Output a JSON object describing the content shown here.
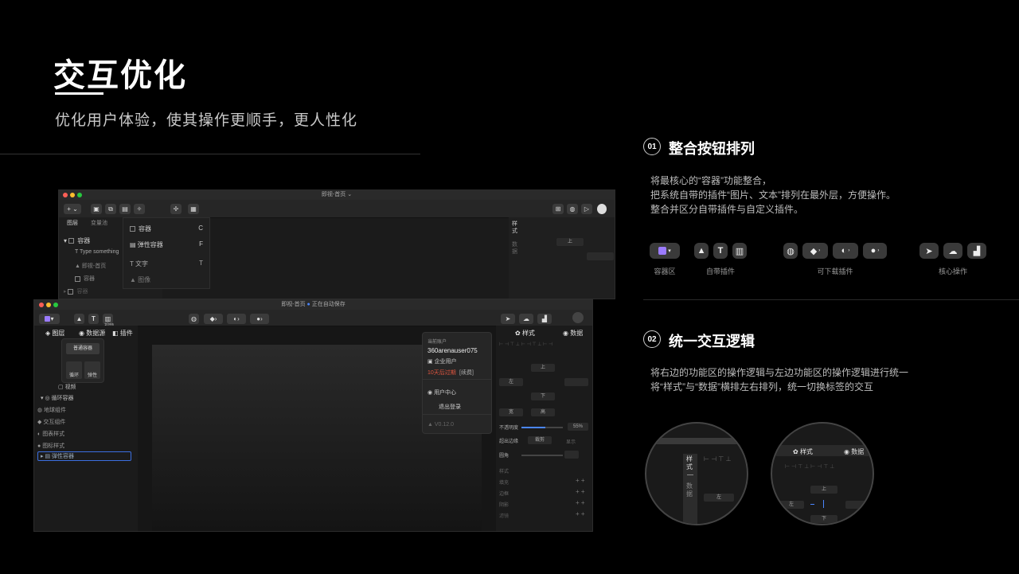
{
  "header": {
    "title": "交互优化",
    "subtitle": "优化用户体验，使其操作更顺手，更人性化"
  },
  "section1": {
    "num": "01",
    "title": "整合按钮排列",
    "desc": "将最核心的“容器”功能整合，\n把系统自带的插件“图片、文本”排列在最外层，方便操作。\n整合并区分自带插件与自定义插件。",
    "groups": [
      {
        "label": "容器区"
      },
      {
        "label": "自带插件"
      },
      {
        "label": "可下载插件"
      },
      {
        "label": "核心操作"
      }
    ]
  },
  "section2": {
    "num": "02",
    "title": "统一交互逻辑",
    "desc": "将右边的功能区的操作逻辑与左边功能区的操作逻辑进行统一\n将“样式”与“数据”横排左右排列，统一切换标签的交互"
  },
  "back_window": {
    "title": "即视-首页",
    "tabs": [
      "图层",
      "变量池"
    ],
    "layers": [
      "容器",
      "Type something",
      "即视-首页",
      "容器",
      "容器"
    ],
    "menu": [
      {
        "label": "容器",
        "key": "C"
      },
      {
        "label": "弹性容器",
        "key": "F"
      },
      {
        "label": "文字",
        "key": "T"
      },
      {
        "label": "图像",
        "key": ""
      }
    ],
    "side_tab": "样式",
    "side_tab2": "数据",
    "field_top": "上"
  },
  "front_window": {
    "title": "即视-首页",
    "autosave": "正在自动保存",
    "tabs": [
      "图层",
      "数据源",
      "插件"
    ],
    "tooltip": "视频",
    "popup_items": [
      "普通容器",
      "循环",
      "弹性"
    ],
    "layers": [
      "视频",
      "循环容器",
      "地球组件",
      "交互组件",
      "图表样式",
      "图标样式",
      "弹性容器"
    ],
    "right_tabs": [
      "样式",
      "数据"
    ],
    "fields": {
      "top": "上",
      "left": "左",
      "bottom": "下",
      "w": "宽",
      "h": "高",
      "opacity_label": "不透明度",
      "opacity_value": "55%",
      "overflow_label": "超出边缘",
      "overflow_value": "裁剪",
      "overflow_show": "显示",
      "radius_label": "圆角"
    },
    "props": [
      "样式",
      "填充",
      "边框",
      "阴影",
      "滤镜"
    ],
    "account": {
      "header": "当前账户",
      "username": "360arenauser075",
      "type": "企业用户",
      "expire": "10天后过期",
      "renew": "[续费]",
      "center": "用户中心",
      "logout": "退出登录",
      "version": "V0.12.0"
    }
  },
  "zoom1": {
    "tab1": "样式",
    "tab2": "数据",
    "field": "左"
  },
  "zoom2": {
    "tab1": "样式",
    "tab2": "数据",
    "top": "上",
    "left": "左",
    "bottom": "下"
  },
  "colors": {
    "bg": "#000000",
    "accent_blue": "#2f6fe0",
    "danger": "#e0553f"
  }
}
